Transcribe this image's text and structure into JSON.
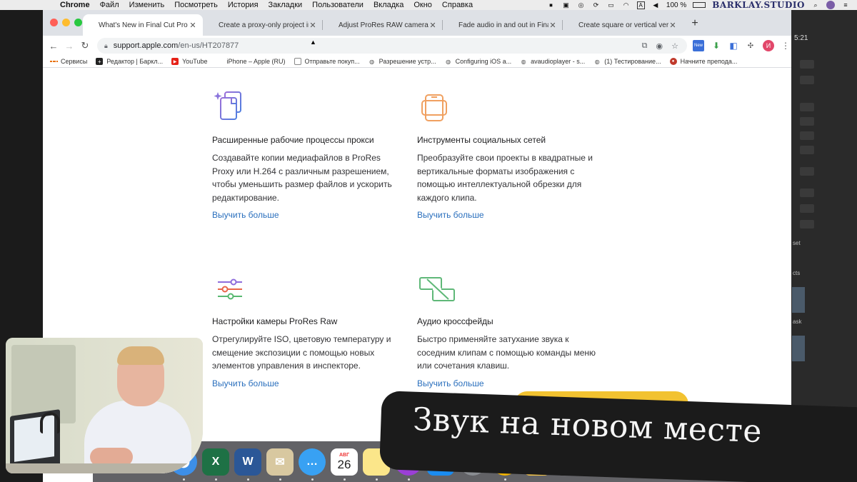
{
  "menubar": {
    "app": "Chrome",
    "items": [
      "Файл",
      "Изменить",
      "Посмотреть",
      "История",
      "Закладки",
      "Пользователи",
      "Вкладка",
      "Окно",
      "Справка"
    ],
    "battery": "100 %",
    "input_source": "A",
    "brand": "BARKLAY.STUDIO"
  },
  "tabs": [
    {
      "title": "What's New in Final Cut Pro X",
      "active": true
    },
    {
      "title": "Create a proxy-only project in F",
      "active": false
    },
    {
      "title": "Adjust ProRes RAW camera sett",
      "active": false
    },
    {
      "title": "Fade audio in and out in Final C",
      "active": false
    },
    {
      "title": "Create square or vertical versio",
      "active": false
    }
  ],
  "omnibox": {
    "host": "support.apple.com",
    "path": "/en-us/HT207877"
  },
  "extensions": {
    "new_badge": "New",
    "profile_initial": "И"
  },
  "bookmarks": [
    {
      "label": "Сервисы",
      "icon": "apps-grid-icon"
    },
    {
      "label": "Редактор | Баркл...",
      "icon": "plus-square-icon"
    },
    {
      "label": "YouTube",
      "icon": "youtube-icon"
    },
    {
      "label": "iPhone – Apple (RU)",
      "icon": "apple-icon"
    },
    {
      "label": "Отправьте покуп...",
      "icon": "doc-icon"
    },
    {
      "label": "Разрешение устр...",
      "icon": "globe-icon"
    },
    {
      "label": "Configuring iOS a...",
      "icon": "globe-icon"
    },
    {
      "label": "avaudioplayer - s...",
      "icon": "globe-icon"
    },
    {
      "label": "(1) Тестирование...",
      "icon": "globe-icon"
    },
    {
      "label": "Начните препода...",
      "icon": "record-icon"
    }
  ],
  "features": [
    {
      "title": "Расширенные рабочие процессы прокси",
      "lines": [
        "Создавайте копии медиафайлов в ProRes",
        "Proxy или H.264 с различным разрешением,",
        "чтобы уменьшить размер файлов и ускорить",
        "редактирование."
      ],
      "link": "Выучить больше",
      "icon": "proxy-files-icon"
    },
    {
      "title": "Инструменты социальных сетей",
      "lines": [
        "Преобразуйте свои проекты в квадратные и",
        "вертикальные форматы изображения с",
        "помощью интеллектуальной обрезки для",
        "каждого клипа."
      ],
      "link": "Выучить больше",
      "icon": "social-phone-icon"
    },
    {
      "title": "Настройки камеры ProRes Raw",
      "lines": [
        "Отрегулируйте ISO, цветовую температуру и",
        "смещение экспозиции с помощью новых",
        "элементов управления в инспекторе."
      ],
      "link": "Выучить больше",
      "icon": "sliders-icon"
    },
    {
      "title": "Аудио кроссфейды",
      "lines": [
        "Быстро применяйте затухание звука к",
        "соседним клипам с помощью команды меню",
        "или сочетания клавиш."
      ],
      "link": "Выучить больше",
      "icon": "crossfade-icon"
    }
  ],
  "dock": {
    "calendar_month": "АВГ",
    "calendar_day": "26"
  },
  "background_app": {
    "time": "5:21",
    "labels": [
      "set",
      "cts",
      "ask"
    ]
  },
  "caption": "Звук на новом месте"
}
